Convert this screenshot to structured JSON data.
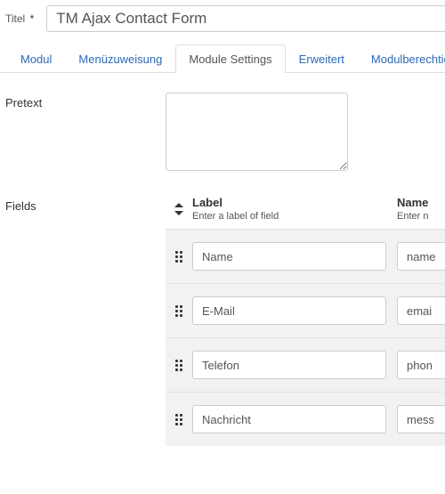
{
  "title": {
    "label": "Titel",
    "required_mark": "*",
    "value": "TM Ajax Contact Form"
  },
  "tabs": {
    "modul": "Modul",
    "menu": "Menüzuweisung",
    "settings": "Module Settings",
    "erweitert": "Erweitert",
    "perms": "Modulberechtigu"
  },
  "pretext": {
    "label": "Pretext",
    "value": ""
  },
  "fields": {
    "label": "Fields",
    "columns": {
      "label_title": "Label",
      "label_hint": "Enter a label of field",
      "name_title": "Name",
      "name_hint": "Enter n"
    },
    "rows": [
      {
        "label": "Name",
        "name": "name"
      },
      {
        "label": "E-Mail",
        "name": "emai"
      },
      {
        "label": "Telefon",
        "name": "phon"
      },
      {
        "label": "Nachricht",
        "name": "mess"
      }
    ]
  }
}
